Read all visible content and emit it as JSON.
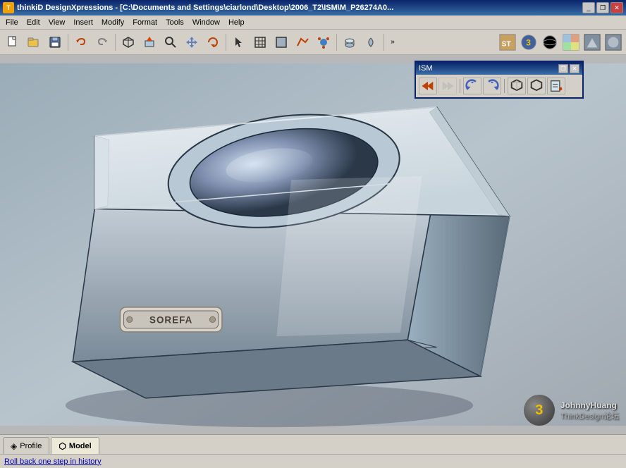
{
  "titleBar": {
    "title": "thinkiD DesignXpressions - [C:\\Documents and Settings\\ciarlond\\Desktop\\2006_T2\\ISM\\M_P26274A0...",
    "icon": "T",
    "controls": {
      "minimize": "_",
      "restore": "❐",
      "close": "✕"
    }
  },
  "menuBar": {
    "items": [
      "File",
      "Edit",
      "View",
      "Insert",
      "Modify",
      "Format",
      "Tools",
      "Window",
      "Help"
    ]
  },
  "toolbar": {
    "buttons": [
      {
        "name": "new",
        "icon": "📄"
      },
      {
        "name": "open",
        "icon": "📂"
      },
      {
        "name": "save",
        "icon": "💾"
      },
      {
        "name": "sep1",
        "icon": null
      },
      {
        "name": "undo",
        "icon": "↩"
      },
      {
        "name": "redo",
        "icon": "↪"
      },
      {
        "name": "sep2",
        "icon": null
      },
      {
        "name": "box",
        "icon": "⬜"
      },
      {
        "name": "push-pull",
        "icon": "⊞"
      },
      {
        "name": "zoom",
        "icon": "🔍"
      },
      {
        "name": "pan",
        "icon": "✋"
      },
      {
        "name": "rotate",
        "icon": "↻"
      },
      {
        "name": "sep3",
        "icon": null
      },
      {
        "name": "mesh",
        "icon": "⊟"
      },
      {
        "name": "sep4",
        "icon": null
      },
      {
        "name": "more",
        "icon": "»"
      }
    ],
    "rightButtons": [
      {
        "name": "r1",
        "icon": "ST"
      },
      {
        "name": "r2",
        "icon": "③"
      },
      {
        "name": "r3",
        "icon": "●"
      },
      {
        "name": "r4",
        "icon": "▦"
      },
      {
        "name": "r5",
        "icon": "🖼"
      },
      {
        "name": "r6",
        "icon": "🖼"
      }
    ]
  },
  "ism": {
    "title": "ISM",
    "controls": {
      "restore": "❐",
      "close": "✕"
    },
    "buttons": [
      {
        "name": "ism-back",
        "icon": "◀◀",
        "disabled": false
      },
      {
        "name": "ism-forward",
        "icon": "▶▶",
        "disabled": true
      },
      {
        "name": "ism-sep"
      },
      {
        "name": "ism-rotate-l",
        "icon": "↺",
        "disabled": false
      },
      {
        "name": "ism-rotate-r",
        "icon": "↻",
        "disabled": false
      },
      {
        "name": "ism-sep2"
      },
      {
        "name": "ism-3d",
        "icon": "⬛",
        "disabled": false
      },
      {
        "name": "ism-view",
        "icon": "◻",
        "disabled": false
      },
      {
        "name": "ism-edit",
        "icon": "✏",
        "disabled": false
      }
    ]
  },
  "tabs": [
    {
      "name": "profile-tab",
      "label": "Profile",
      "icon": "◈",
      "active": false
    },
    {
      "name": "model-tab",
      "label": "Model",
      "icon": "⬡",
      "active": true
    }
  ],
  "statusBar": {
    "message": "Roll back one step in history",
    "rightText": ""
  },
  "viewport": {
    "bgColor": "#b0b8c0"
  },
  "logo": {
    "number": "3",
    "line1": "JohnnyHuang",
    "line2": "ThinkDesign论坛"
  }
}
